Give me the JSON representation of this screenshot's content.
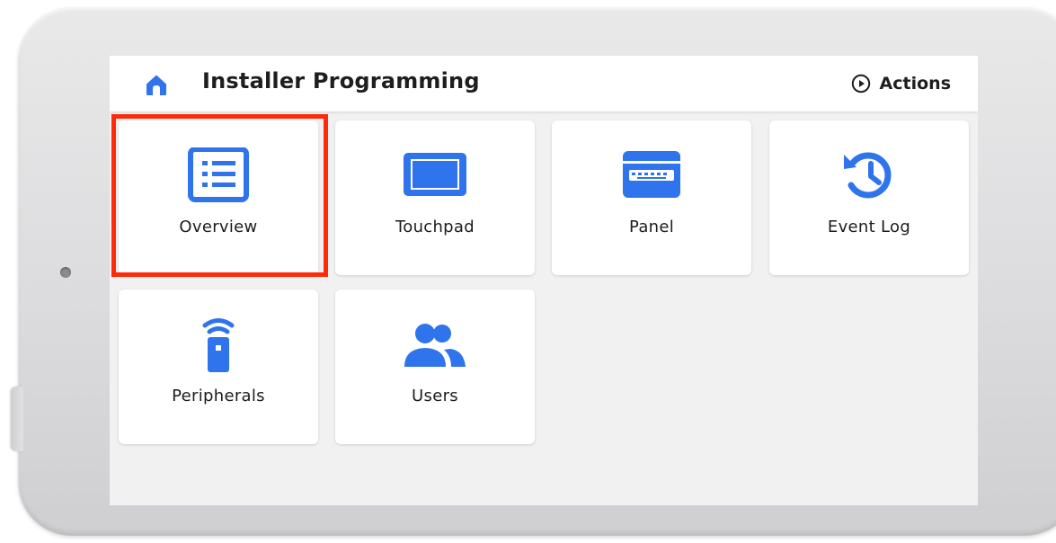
{
  "app_bar": {
    "title": "Installer Programming",
    "actions_label": "Actions"
  },
  "tiles": [
    {
      "label": "Overview",
      "icon": "list-icon"
    },
    {
      "label": "Touchpad",
      "icon": "tablet-icon"
    },
    {
      "label": "Panel",
      "icon": "keypad-icon"
    },
    {
      "label": "Event Log",
      "icon": "history-icon"
    },
    {
      "label": "Peripherals",
      "icon": "remote-icon"
    },
    {
      "label": "Users",
      "icon": "users-icon"
    }
  ],
  "highlighted_tile": "Overview",
  "colors": {
    "accent": "#2f74ec",
    "highlight": "#ff2a0a",
    "screen_bg": "#f1f1f1"
  }
}
